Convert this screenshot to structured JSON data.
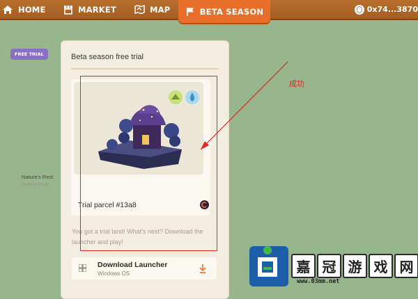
{
  "nav": {
    "items": [
      {
        "label": "HOME",
        "icon": "home-icon"
      },
      {
        "label": "MARKET",
        "icon": "market-icon"
      },
      {
        "label": "MAP",
        "icon": "map-icon"
      },
      {
        "label": "BETA SEASON",
        "icon": "flag-icon",
        "active": true
      }
    ],
    "wallet": "0x74...3870"
  },
  "panel": {
    "title": "Beta season free trial",
    "card": {
      "badge": "FREE TRIAL",
      "parcel_name": "Nature's Rest",
      "parcel_sub": "Pioneer Point",
      "trial_label": "Trial parcel #13a8"
    },
    "info": "You got a trial land! What's next? Download the launcher and play!",
    "download": {
      "title": "Download Launcher",
      "subtitle": "Windows OS"
    }
  },
  "annotation": {
    "text": "成功",
    "color": "#e0261f"
  },
  "watermark": {
    "chars": [
      "嘉",
      "冠",
      "游",
      "戏",
      "网"
    ],
    "url": "www.03mm.net"
  },
  "colors": {
    "background": "#97b68d",
    "topbar": "#a86227",
    "active_tab": "#e76f2a",
    "badge": "#8870c2"
  }
}
